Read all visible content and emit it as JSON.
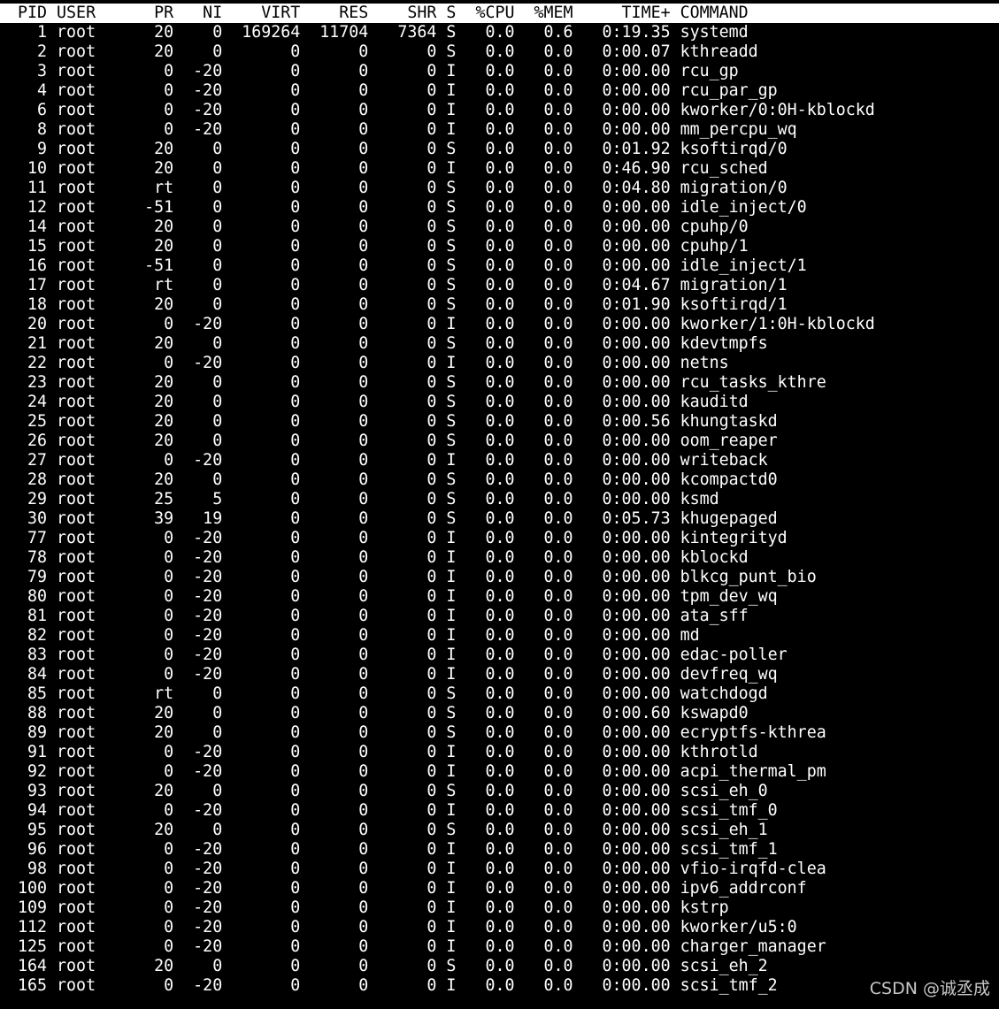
{
  "header": {
    "columns": [
      "PID",
      "USER",
      "PR",
      "NI",
      "VIRT",
      "RES",
      "SHR",
      "S",
      "%CPU",
      "%MEM",
      "TIME+",
      "COMMAND"
    ]
  },
  "processes": [
    {
      "pid": "1",
      "user": "root",
      "pr": "20",
      "ni": "0",
      "virt": "169264",
      "res": "11704",
      "shr": "7364",
      "s": "S",
      "cpu": "0.0",
      "mem": "0.6",
      "time": "0:19.35",
      "command": "systemd"
    },
    {
      "pid": "2",
      "user": "root",
      "pr": "20",
      "ni": "0",
      "virt": "0",
      "res": "0",
      "shr": "0",
      "s": "S",
      "cpu": "0.0",
      "mem": "0.0",
      "time": "0:00.07",
      "command": "kthreadd"
    },
    {
      "pid": "3",
      "user": "root",
      "pr": "0",
      "ni": "-20",
      "virt": "0",
      "res": "0",
      "shr": "0",
      "s": "I",
      "cpu": "0.0",
      "mem": "0.0",
      "time": "0:00.00",
      "command": "rcu_gp"
    },
    {
      "pid": "4",
      "user": "root",
      "pr": "0",
      "ni": "-20",
      "virt": "0",
      "res": "0",
      "shr": "0",
      "s": "I",
      "cpu": "0.0",
      "mem": "0.0",
      "time": "0:00.00",
      "command": "rcu_par_gp"
    },
    {
      "pid": "6",
      "user": "root",
      "pr": "0",
      "ni": "-20",
      "virt": "0",
      "res": "0",
      "shr": "0",
      "s": "I",
      "cpu": "0.0",
      "mem": "0.0",
      "time": "0:00.00",
      "command": "kworker/0:0H-kblockd"
    },
    {
      "pid": "8",
      "user": "root",
      "pr": "0",
      "ni": "-20",
      "virt": "0",
      "res": "0",
      "shr": "0",
      "s": "I",
      "cpu": "0.0",
      "mem": "0.0",
      "time": "0:00.00",
      "command": "mm_percpu_wq"
    },
    {
      "pid": "9",
      "user": "root",
      "pr": "20",
      "ni": "0",
      "virt": "0",
      "res": "0",
      "shr": "0",
      "s": "S",
      "cpu": "0.0",
      "mem": "0.0",
      "time": "0:01.92",
      "command": "ksoftirqd/0"
    },
    {
      "pid": "10",
      "user": "root",
      "pr": "20",
      "ni": "0",
      "virt": "0",
      "res": "0",
      "shr": "0",
      "s": "I",
      "cpu": "0.0",
      "mem": "0.0",
      "time": "0:46.90",
      "command": "rcu_sched"
    },
    {
      "pid": "11",
      "user": "root",
      "pr": "rt",
      "ni": "0",
      "virt": "0",
      "res": "0",
      "shr": "0",
      "s": "S",
      "cpu": "0.0",
      "mem": "0.0",
      "time": "0:04.80",
      "command": "migration/0"
    },
    {
      "pid": "12",
      "user": "root",
      "pr": "-51",
      "ni": "0",
      "virt": "0",
      "res": "0",
      "shr": "0",
      "s": "S",
      "cpu": "0.0",
      "mem": "0.0",
      "time": "0:00.00",
      "command": "idle_inject/0"
    },
    {
      "pid": "14",
      "user": "root",
      "pr": "20",
      "ni": "0",
      "virt": "0",
      "res": "0",
      "shr": "0",
      "s": "S",
      "cpu": "0.0",
      "mem": "0.0",
      "time": "0:00.00",
      "command": "cpuhp/0"
    },
    {
      "pid": "15",
      "user": "root",
      "pr": "20",
      "ni": "0",
      "virt": "0",
      "res": "0",
      "shr": "0",
      "s": "S",
      "cpu": "0.0",
      "mem": "0.0",
      "time": "0:00.00",
      "command": "cpuhp/1"
    },
    {
      "pid": "16",
      "user": "root",
      "pr": "-51",
      "ni": "0",
      "virt": "0",
      "res": "0",
      "shr": "0",
      "s": "S",
      "cpu": "0.0",
      "mem": "0.0",
      "time": "0:00.00",
      "command": "idle_inject/1"
    },
    {
      "pid": "17",
      "user": "root",
      "pr": "rt",
      "ni": "0",
      "virt": "0",
      "res": "0",
      "shr": "0",
      "s": "S",
      "cpu": "0.0",
      "mem": "0.0",
      "time": "0:04.67",
      "command": "migration/1"
    },
    {
      "pid": "18",
      "user": "root",
      "pr": "20",
      "ni": "0",
      "virt": "0",
      "res": "0",
      "shr": "0",
      "s": "S",
      "cpu": "0.0",
      "mem": "0.0",
      "time": "0:01.90",
      "command": "ksoftirqd/1"
    },
    {
      "pid": "20",
      "user": "root",
      "pr": "0",
      "ni": "-20",
      "virt": "0",
      "res": "0",
      "shr": "0",
      "s": "I",
      "cpu": "0.0",
      "mem": "0.0",
      "time": "0:00.00",
      "command": "kworker/1:0H-kblockd"
    },
    {
      "pid": "21",
      "user": "root",
      "pr": "20",
      "ni": "0",
      "virt": "0",
      "res": "0",
      "shr": "0",
      "s": "S",
      "cpu": "0.0",
      "mem": "0.0",
      "time": "0:00.00",
      "command": "kdevtmpfs"
    },
    {
      "pid": "22",
      "user": "root",
      "pr": "0",
      "ni": "-20",
      "virt": "0",
      "res": "0",
      "shr": "0",
      "s": "I",
      "cpu": "0.0",
      "mem": "0.0",
      "time": "0:00.00",
      "command": "netns"
    },
    {
      "pid": "23",
      "user": "root",
      "pr": "20",
      "ni": "0",
      "virt": "0",
      "res": "0",
      "shr": "0",
      "s": "S",
      "cpu": "0.0",
      "mem": "0.0",
      "time": "0:00.00",
      "command": "rcu_tasks_kthre"
    },
    {
      "pid": "24",
      "user": "root",
      "pr": "20",
      "ni": "0",
      "virt": "0",
      "res": "0",
      "shr": "0",
      "s": "S",
      "cpu": "0.0",
      "mem": "0.0",
      "time": "0:00.00",
      "command": "kauditd"
    },
    {
      "pid": "25",
      "user": "root",
      "pr": "20",
      "ni": "0",
      "virt": "0",
      "res": "0",
      "shr": "0",
      "s": "S",
      "cpu": "0.0",
      "mem": "0.0",
      "time": "0:00.56",
      "command": "khungtaskd"
    },
    {
      "pid": "26",
      "user": "root",
      "pr": "20",
      "ni": "0",
      "virt": "0",
      "res": "0",
      "shr": "0",
      "s": "S",
      "cpu": "0.0",
      "mem": "0.0",
      "time": "0:00.00",
      "command": "oom_reaper"
    },
    {
      "pid": "27",
      "user": "root",
      "pr": "0",
      "ni": "-20",
      "virt": "0",
      "res": "0",
      "shr": "0",
      "s": "I",
      "cpu": "0.0",
      "mem": "0.0",
      "time": "0:00.00",
      "command": "writeback"
    },
    {
      "pid": "28",
      "user": "root",
      "pr": "20",
      "ni": "0",
      "virt": "0",
      "res": "0",
      "shr": "0",
      "s": "S",
      "cpu": "0.0",
      "mem": "0.0",
      "time": "0:00.00",
      "command": "kcompactd0"
    },
    {
      "pid": "29",
      "user": "root",
      "pr": "25",
      "ni": "5",
      "virt": "0",
      "res": "0",
      "shr": "0",
      "s": "S",
      "cpu": "0.0",
      "mem": "0.0",
      "time": "0:00.00",
      "command": "ksmd"
    },
    {
      "pid": "30",
      "user": "root",
      "pr": "39",
      "ni": "19",
      "virt": "0",
      "res": "0",
      "shr": "0",
      "s": "S",
      "cpu": "0.0",
      "mem": "0.0",
      "time": "0:05.73",
      "command": "khugepaged"
    },
    {
      "pid": "77",
      "user": "root",
      "pr": "0",
      "ni": "-20",
      "virt": "0",
      "res": "0",
      "shr": "0",
      "s": "I",
      "cpu": "0.0",
      "mem": "0.0",
      "time": "0:00.00",
      "command": "kintegrityd"
    },
    {
      "pid": "78",
      "user": "root",
      "pr": "0",
      "ni": "-20",
      "virt": "0",
      "res": "0",
      "shr": "0",
      "s": "I",
      "cpu": "0.0",
      "mem": "0.0",
      "time": "0:00.00",
      "command": "kblockd"
    },
    {
      "pid": "79",
      "user": "root",
      "pr": "0",
      "ni": "-20",
      "virt": "0",
      "res": "0",
      "shr": "0",
      "s": "I",
      "cpu": "0.0",
      "mem": "0.0",
      "time": "0:00.00",
      "command": "blkcg_punt_bio"
    },
    {
      "pid": "80",
      "user": "root",
      "pr": "0",
      "ni": "-20",
      "virt": "0",
      "res": "0",
      "shr": "0",
      "s": "I",
      "cpu": "0.0",
      "mem": "0.0",
      "time": "0:00.00",
      "command": "tpm_dev_wq"
    },
    {
      "pid": "81",
      "user": "root",
      "pr": "0",
      "ni": "-20",
      "virt": "0",
      "res": "0",
      "shr": "0",
      "s": "I",
      "cpu": "0.0",
      "mem": "0.0",
      "time": "0:00.00",
      "command": "ata_sff"
    },
    {
      "pid": "82",
      "user": "root",
      "pr": "0",
      "ni": "-20",
      "virt": "0",
      "res": "0",
      "shr": "0",
      "s": "I",
      "cpu": "0.0",
      "mem": "0.0",
      "time": "0:00.00",
      "command": "md"
    },
    {
      "pid": "83",
      "user": "root",
      "pr": "0",
      "ni": "-20",
      "virt": "0",
      "res": "0",
      "shr": "0",
      "s": "I",
      "cpu": "0.0",
      "mem": "0.0",
      "time": "0:00.00",
      "command": "edac-poller"
    },
    {
      "pid": "84",
      "user": "root",
      "pr": "0",
      "ni": "-20",
      "virt": "0",
      "res": "0",
      "shr": "0",
      "s": "I",
      "cpu": "0.0",
      "mem": "0.0",
      "time": "0:00.00",
      "command": "devfreq_wq"
    },
    {
      "pid": "85",
      "user": "root",
      "pr": "rt",
      "ni": "0",
      "virt": "0",
      "res": "0",
      "shr": "0",
      "s": "S",
      "cpu": "0.0",
      "mem": "0.0",
      "time": "0:00.00",
      "command": "watchdogd"
    },
    {
      "pid": "88",
      "user": "root",
      "pr": "20",
      "ni": "0",
      "virt": "0",
      "res": "0",
      "shr": "0",
      "s": "S",
      "cpu": "0.0",
      "mem": "0.0",
      "time": "0:00.60",
      "command": "kswapd0"
    },
    {
      "pid": "89",
      "user": "root",
      "pr": "20",
      "ni": "0",
      "virt": "0",
      "res": "0",
      "shr": "0",
      "s": "S",
      "cpu": "0.0",
      "mem": "0.0",
      "time": "0:00.00",
      "command": "ecryptfs-kthrea"
    },
    {
      "pid": "91",
      "user": "root",
      "pr": "0",
      "ni": "-20",
      "virt": "0",
      "res": "0",
      "shr": "0",
      "s": "I",
      "cpu": "0.0",
      "mem": "0.0",
      "time": "0:00.00",
      "command": "kthrotld"
    },
    {
      "pid": "92",
      "user": "root",
      "pr": "0",
      "ni": "-20",
      "virt": "0",
      "res": "0",
      "shr": "0",
      "s": "I",
      "cpu": "0.0",
      "mem": "0.0",
      "time": "0:00.00",
      "command": "acpi_thermal_pm"
    },
    {
      "pid": "93",
      "user": "root",
      "pr": "20",
      "ni": "0",
      "virt": "0",
      "res": "0",
      "shr": "0",
      "s": "S",
      "cpu": "0.0",
      "mem": "0.0",
      "time": "0:00.00",
      "command": "scsi_eh_0"
    },
    {
      "pid": "94",
      "user": "root",
      "pr": "0",
      "ni": "-20",
      "virt": "0",
      "res": "0",
      "shr": "0",
      "s": "I",
      "cpu": "0.0",
      "mem": "0.0",
      "time": "0:00.00",
      "command": "scsi_tmf_0"
    },
    {
      "pid": "95",
      "user": "root",
      "pr": "20",
      "ni": "0",
      "virt": "0",
      "res": "0",
      "shr": "0",
      "s": "S",
      "cpu": "0.0",
      "mem": "0.0",
      "time": "0:00.00",
      "command": "scsi_eh_1"
    },
    {
      "pid": "96",
      "user": "root",
      "pr": "0",
      "ni": "-20",
      "virt": "0",
      "res": "0",
      "shr": "0",
      "s": "I",
      "cpu": "0.0",
      "mem": "0.0",
      "time": "0:00.00",
      "command": "scsi_tmf_1"
    },
    {
      "pid": "98",
      "user": "root",
      "pr": "0",
      "ni": "-20",
      "virt": "0",
      "res": "0",
      "shr": "0",
      "s": "I",
      "cpu": "0.0",
      "mem": "0.0",
      "time": "0:00.00",
      "command": "vfio-irqfd-clea"
    },
    {
      "pid": "100",
      "user": "root",
      "pr": "0",
      "ni": "-20",
      "virt": "0",
      "res": "0",
      "shr": "0",
      "s": "I",
      "cpu": "0.0",
      "mem": "0.0",
      "time": "0:00.00",
      "command": "ipv6_addrconf"
    },
    {
      "pid": "109",
      "user": "root",
      "pr": "0",
      "ni": "-20",
      "virt": "0",
      "res": "0",
      "shr": "0",
      "s": "I",
      "cpu": "0.0",
      "mem": "0.0",
      "time": "0:00.00",
      "command": "kstrp"
    },
    {
      "pid": "112",
      "user": "root",
      "pr": "0",
      "ni": "-20",
      "virt": "0",
      "res": "0",
      "shr": "0",
      "s": "I",
      "cpu": "0.0",
      "mem": "0.0",
      "time": "0:00.00",
      "command": "kworker/u5:0"
    },
    {
      "pid": "125",
      "user": "root",
      "pr": "0",
      "ni": "-20",
      "virt": "0",
      "res": "0",
      "shr": "0",
      "s": "I",
      "cpu": "0.0",
      "mem": "0.0",
      "time": "0:00.00",
      "command": "charger_manager"
    },
    {
      "pid": "164",
      "user": "root",
      "pr": "20",
      "ni": "0",
      "virt": "0",
      "res": "0",
      "shr": "0",
      "s": "S",
      "cpu": "0.0",
      "mem": "0.0",
      "time": "0:00.00",
      "command": "scsi_eh_2"
    },
    {
      "pid": "165",
      "user": "root",
      "pr": "0",
      "ni": "-20",
      "virt": "0",
      "res": "0",
      "shr": "0",
      "s": "I",
      "cpu": "0.0",
      "mem": "0.0",
      "time": "0:00.00",
      "command": "scsi_tmf_2"
    }
  ],
  "watermark": "CSDN @诚丞成",
  "colors": {
    "background": "#000000",
    "foreground": "#ffffff",
    "header_background": "#ffffff",
    "header_foreground": "#000000"
  }
}
